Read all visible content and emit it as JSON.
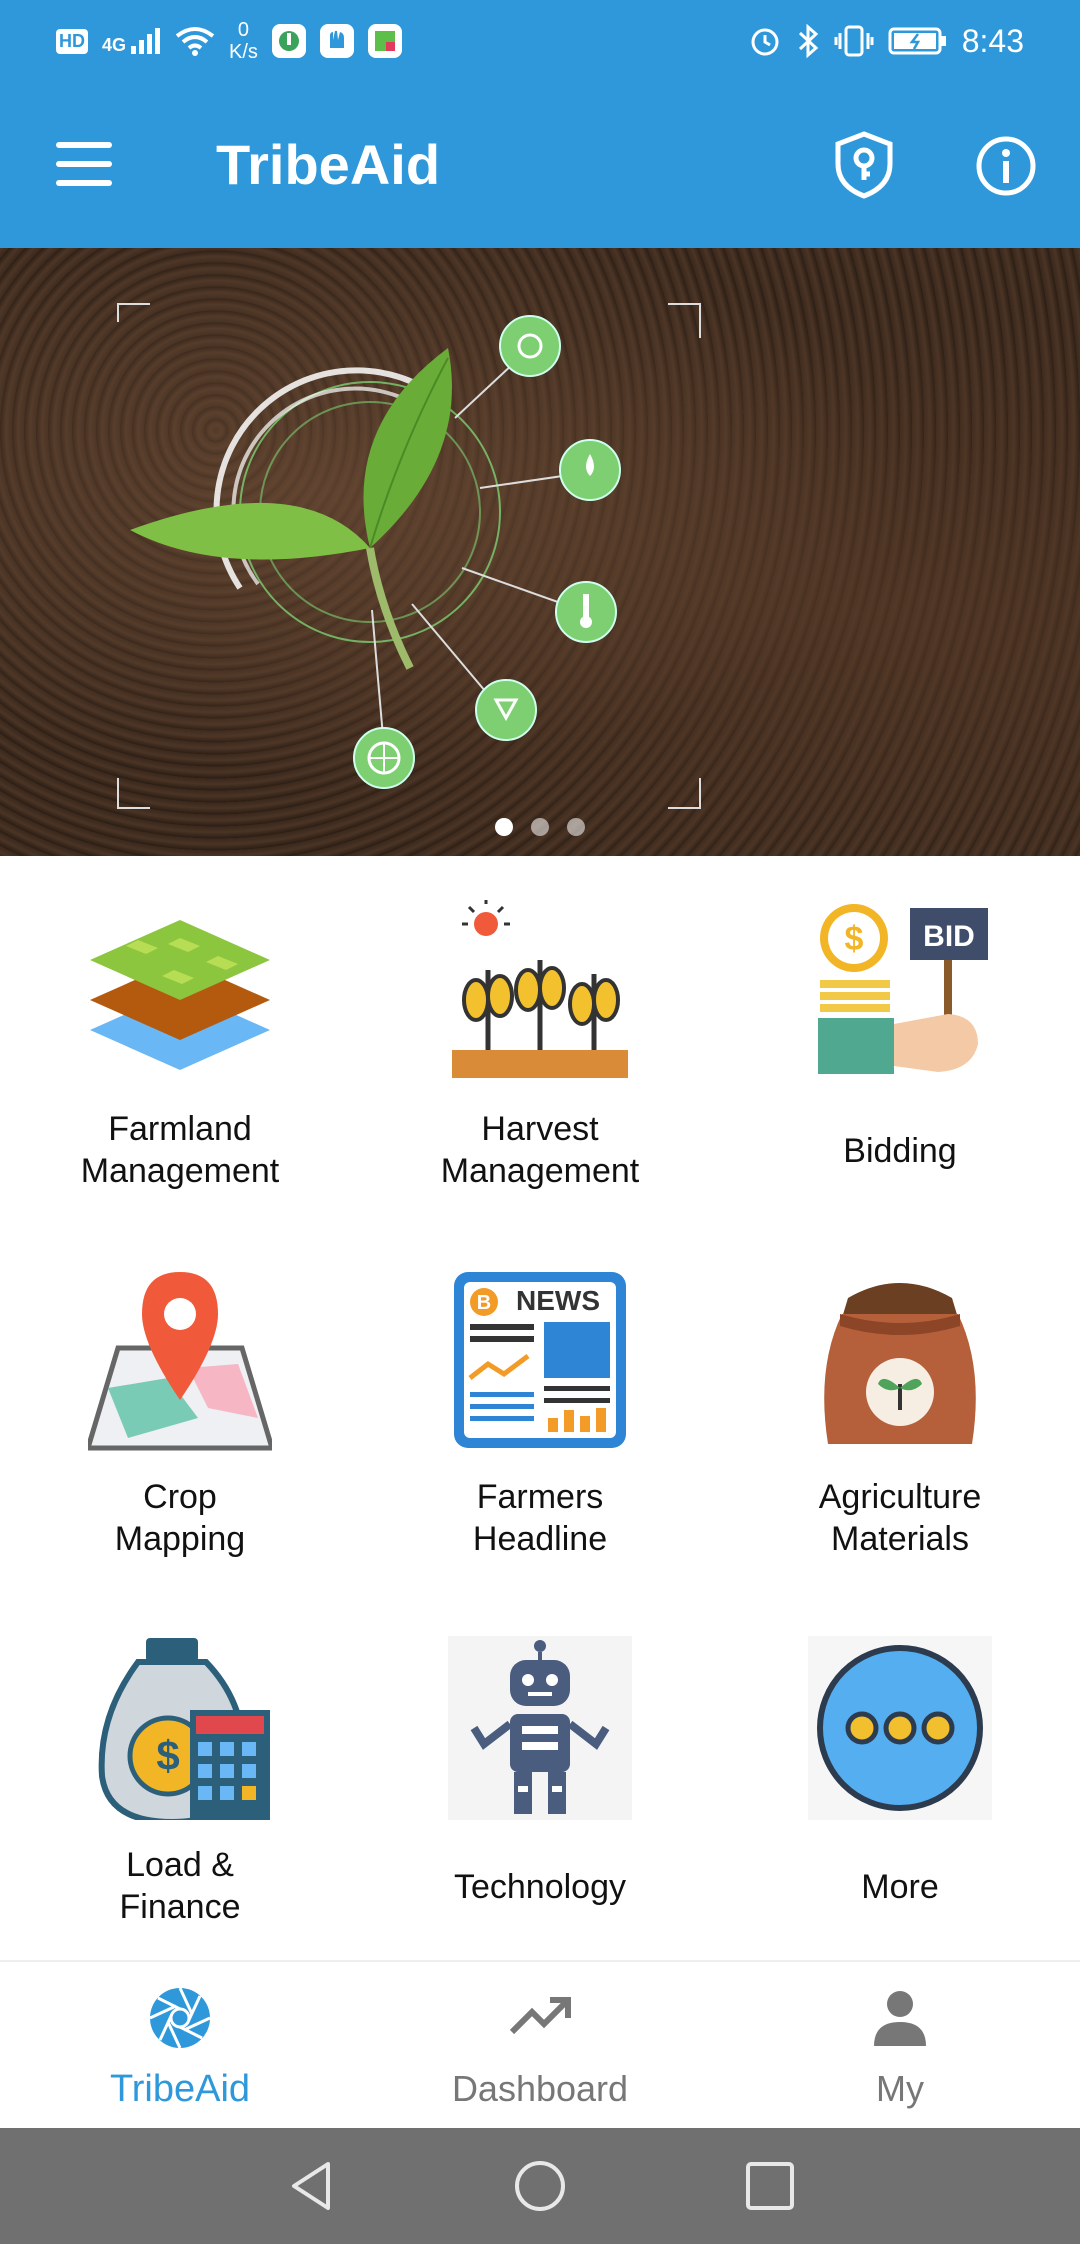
{
  "status_bar": {
    "network_badge": "HD",
    "signal": "4G",
    "net_speed_value": "0",
    "net_speed_unit": "K/s",
    "time": "8:43",
    "icons": [
      "hd-icon",
      "signal-icon",
      "wifi-icon",
      "app-icon",
      "app-icon",
      "app-icon",
      "alarm-icon",
      "bluetooth-icon",
      "vibrate-icon",
      "battery-icon"
    ]
  },
  "app_bar": {
    "title": "TribeAid",
    "icons": [
      "menu-icon",
      "shield-icon",
      "info-icon"
    ]
  },
  "banner": {
    "slides": 3,
    "active_slide": 1
  },
  "grid": {
    "items": [
      {
        "label": "Farmland\nManagement",
        "icon": "farmland-layers-icon"
      },
      {
        "label": "Harvest\nManagement",
        "icon": "harvest-plants-icon"
      },
      {
        "label": "Bidding",
        "icon": "bid-sign-icon"
      },
      {
        "label": "Crop\nMapping",
        "icon": "map-pin-icon"
      },
      {
        "label": "Farmers\nHeadline",
        "icon": "news-icon"
      },
      {
        "label": "Agriculture\nMaterials",
        "icon": "seed-sack-icon"
      },
      {
        "label": "Load &\nFinance",
        "icon": "money-bag-icon"
      },
      {
        "label": "Technology",
        "icon": "robot-icon"
      },
      {
        "label": "More",
        "icon": "more-dots-icon"
      }
    ]
  },
  "bottom_nav": {
    "items": [
      {
        "label": "TribeAid",
        "icon": "aperture-icon",
        "active": true
      },
      {
        "label": "Dashboard",
        "icon": "trending-up-icon",
        "active": false
      },
      {
        "label": "My",
        "icon": "person-icon",
        "active": false
      }
    ]
  },
  "colors": {
    "primary": "#2e98db",
    "nav_inactive": "#777777",
    "system_nav": "#707070"
  }
}
